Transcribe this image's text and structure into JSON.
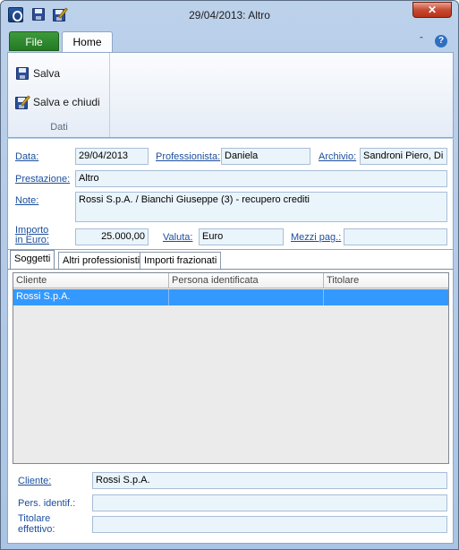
{
  "window": {
    "title": "29/04/2013: Altro",
    "close_label": "✕"
  },
  "ribbon": {
    "tabs": {
      "file": "File",
      "home": "Home"
    },
    "minimize_glyph": "ˆ",
    "help_glyph": "?",
    "buttons": {
      "save": "Salva",
      "save_close": "Salva e chiudi"
    },
    "group_label": "Dati"
  },
  "form": {
    "data_label": "Data:",
    "data_value": "29/04/2013",
    "professionista_label": "Professionista:",
    "professionista_value": "Daniela",
    "archivio_label": "Archivio:",
    "archivio_value": "Sandroni Piero, Di B",
    "prestazione_label": "Prestazione:",
    "prestazione_value": "Altro",
    "note_label": "Note:",
    "note_value": "Rossi S.p.A. / Bianchi Giuseppe (3) - recupero crediti",
    "importo_label_1": "Importo",
    "importo_label_2": "in Euro:",
    "importo_value": "25.000,00",
    "valuta_label": "Valuta:",
    "valuta_value": "Euro",
    "mezzi_label": "Mezzi pag.:",
    "mezzi_value": ""
  },
  "tabs": [
    "Soggetti",
    "Altri professionisti",
    "Importi frazionati"
  ],
  "grid": {
    "columns": [
      "Cliente",
      "Persona identificata",
      "Titolare"
    ],
    "rows": [
      {
        "cliente": "Rossi S.p.A.",
        "persona": "",
        "titolare": ""
      }
    ]
  },
  "detail": {
    "cliente_label": "Cliente:",
    "cliente_value": "Rossi S.p.A.",
    "pers_label": "Pers. identif.:",
    "pers_value": "",
    "titolare_label_1": "Titolare",
    "titolare_label_2": "effettivo:",
    "titolare_value": ""
  }
}
